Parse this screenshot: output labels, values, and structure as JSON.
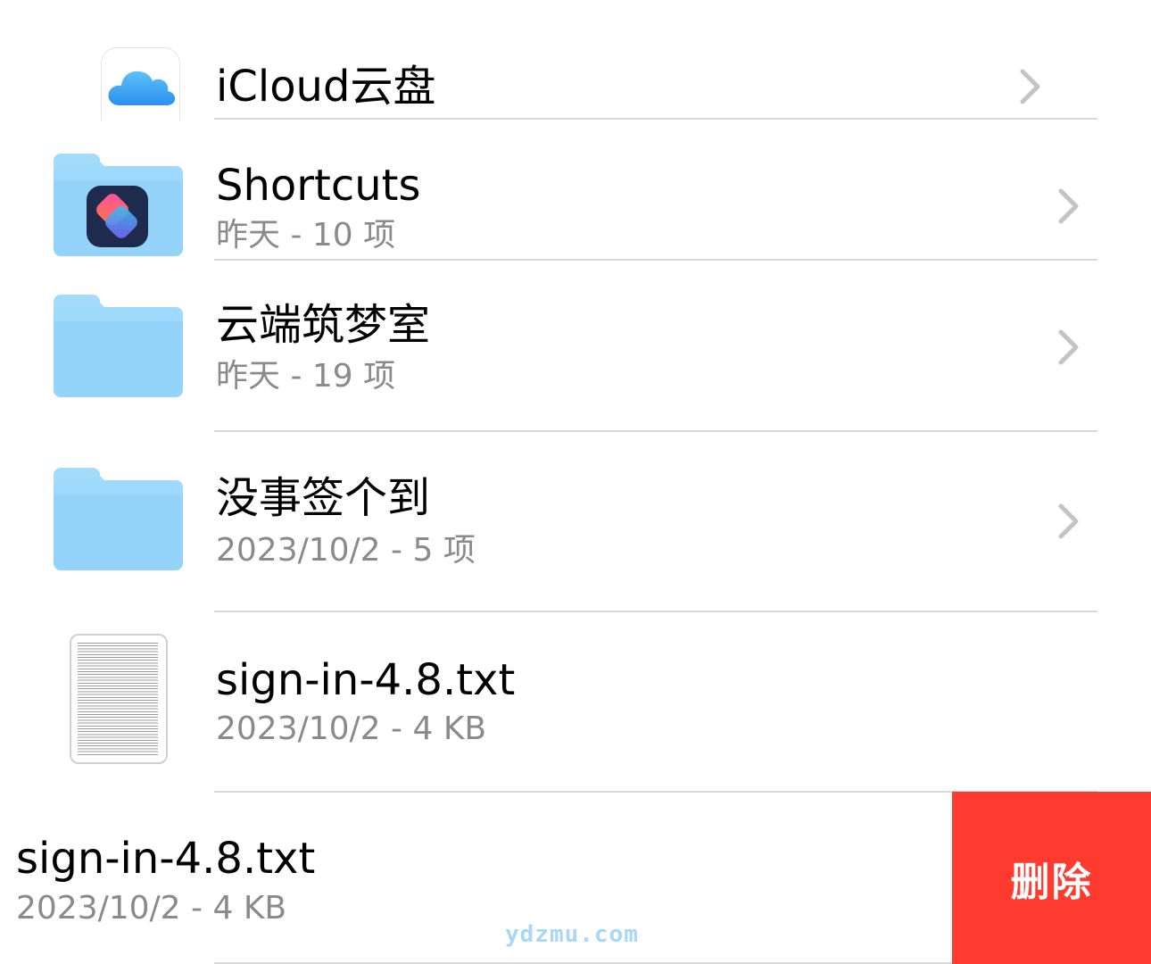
{
  "items": [
    {
      "title": "iCloud云盘",
      "subtitle": "",
      "icon": "icloud-icon"
    },
    {
      "title": "Shortcuts",
      "subtitle": "昨天 - 10 项",
      "icon": "shortcuts-folder-icon"
    },
    {
      "title": "云端筑梦室",
      "subtitle": "昨天 - 19 项",
      "icon": "folder-icon"
    },
    {
      "title": "没事签个到",
      "subtitle": "2023/10/2 - 5 项",
      "icon": "folder-icon"
    },
    {
      "title": "sign-in-4.8.txt",
      "subtitle": "2023/10/2 - 4 KB",
      "icon": "txt-file-icon"
    }
  ],
  "swiped_row": {
    "title": "sign-in-4.8.txt",
    "subtitle": "2023/10/2 - 4 KB",
    "delete_label": "删除"
  },
  "watermark": "ydzmu.com",
  "colors": {
    "delete": "#ff3b30",
    "folder": "#94d3fa",
    "subtitle": "#8a8a8e",
    "separator": "#d9d9dc",
    "chevron": "#c4c4c7"
  }
}
